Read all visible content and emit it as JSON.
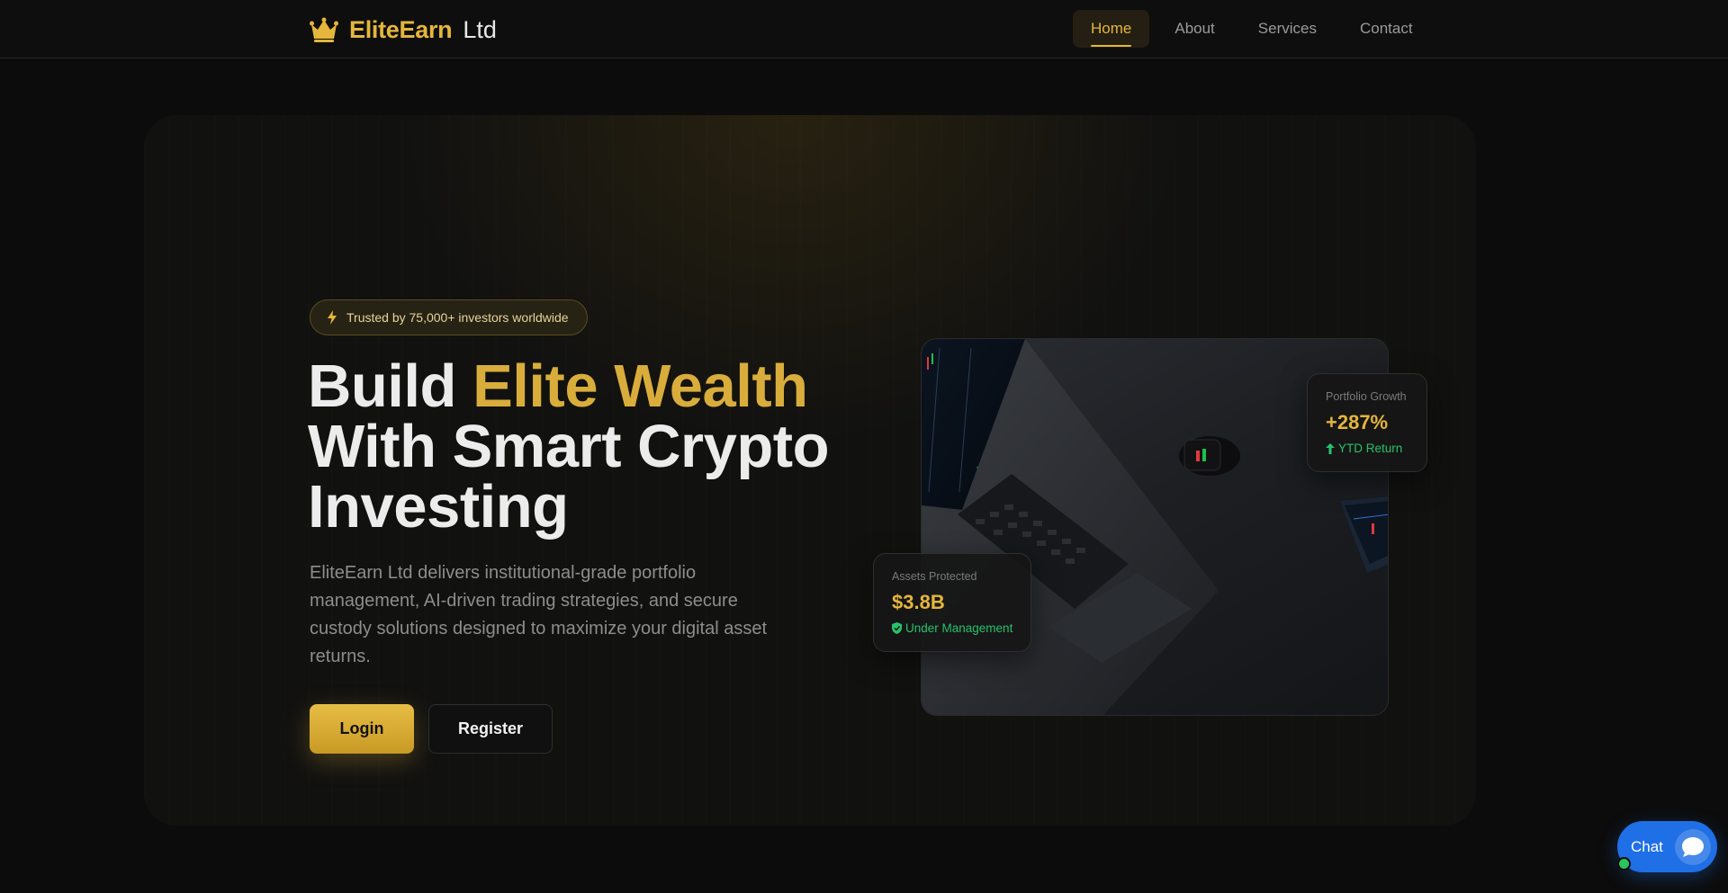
{
  "header": {
    "brand": "EliteEarn",
    "brand_suffix": "Ltd",
    "logo_icon": "crown-icon",
    "nav": [
      {
        "label": "Home",
        "active": true
      },
      {
        "label": "About",
        "active": false
      },
      {
        "label": "Services",
        "active": false
      },
      {
        "label": "Contact",
        "active": false
      }
    ]
  },
  "hero": {
    "badge": {
      "icon": "lightning-bolt-icon",
      "text": "Trusted by 75,000+ investors worldwide"
    },
    "headline": {
      "line1_prefix": "Build ",
      "line1_highlight": "Elite Wealth",
      "line2": "With Smart Crypto",
      "line3": "Investing"
    },
    "subtext": "EliteEarn Ltd delivers institutional-grade portfolio management, AI-driven trading strategies, and secure custody solutions designed to maximize your digital asset returns.",
    "buttons": {
      "login": "Login",
      "register": "Register"
    }
  },
  "stats": {
    "growth": {
      "label": "Portfolio Growth",
      "value": "+287%",
      "sub": "YTD Return",
      "sub_icon": "arrow-up-icon"
    },
    "assets": {
      "label": "Assets Protected",
      "value": "$3.8B",
      "sub": "Under Management",
      "sub_icon": "shield-icon"
    }
  },
  "chat": {
    "label": "Chat",
    "icon": "chat-bubble-icon"
  },
  "colors": {
    "gold": "#e5b63c",
    "background": "#0c0c0c",
    "chat_blue": "#1f6fe6",
    "success_green": "#27c26a"
  }
}
